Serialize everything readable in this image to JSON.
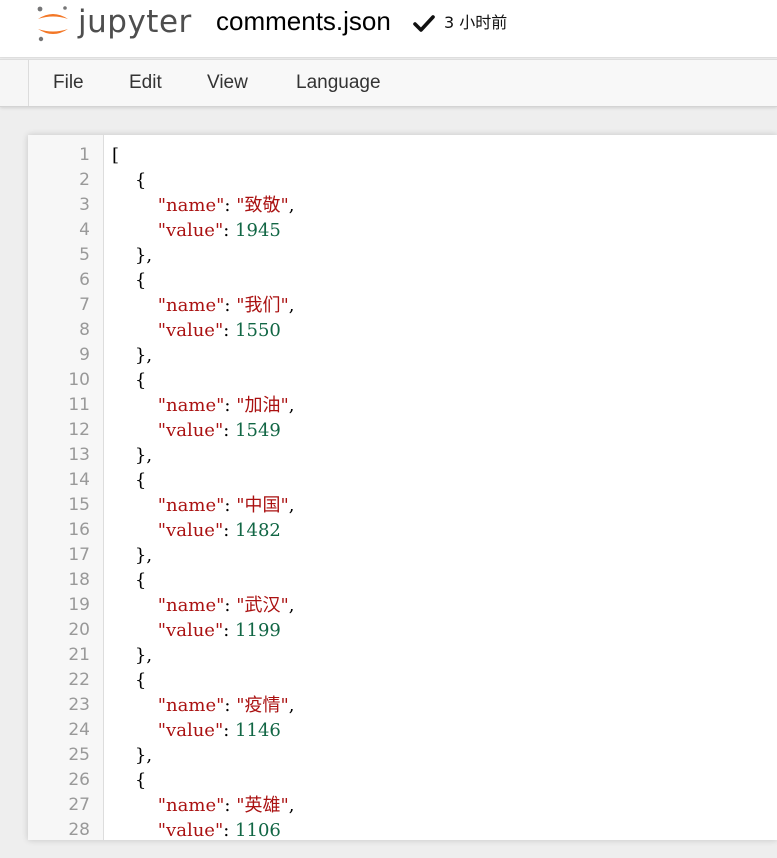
{
  "header": {
    "logo_text": "jupyter",
    "notebook_name": "comments.json",
    "save_status": "3 小时前"
  },
  "menu": {
    "items": [
      {
        "label": "File"
      },
      {
        "label": "Edit"
      },
      {
        "label": "View"
      },
      {
        "label": "Language"
      }
    ]
  },
  "colors": {
    "string": "#aa1111",
    "number": "#116644",
    "line_number": "#999999",
    "logo_orange": "#f37726",
    "logo_gray": "#767677"
  },
  "icons": {
    "logo": "jupyter-logo-icon",
    "checkpoint": "checkmark-icon"
  },
  "editor": {
    "lines": [
      {
        "num": "1",
        "tokens": [
          {
            "t": "punct",
            "v": "["
          }
        ]
      },
      {
        "num": "2",
        "tokens": [
          {
            "t": "punct",
            "v": "    {"
          }
        ]
      },
      {
        "num": "3",
        "tokens": [
          {
            "t": "punct",
            "v": "        "
          },
          {
            "t": "string",
            "v": "\"name\""
          },
          {
            "t": "punct",
            "v": ": "
          },
          {
            "t": "string",
            "v": "\"致敬\""
          },
          {
            "t": "punct",
            "v": ","
          }
        ]
      },
      {
        "num": "4",
        "tokens": [
          {
            "t": "punct",
            "v": "        "
          },
          {
            "t": "string",
            "v": "\"value\""
          },
          {
            "t": "punct",
            "v": ": "
          },
          {
            "t": "number",
            "v": "1945"
          }
        ]
      },
      {
        "num": "5",
        "tokens": [
          {
            "t": "punct",
            "v": "    },"
          }
        ]
      },
      {
        "num": "6",
        "tokens": [
          {
            "t": "punct",
            "v": "    {"
          }
        ]
      },
      {
        "num": "7",
        "tokens": [
          {
            "t": "punct",
            "v": "        "
          },
          {
            "t": "string",
            "v": "\"name\""
          },
          {
            "t": "punct",
            "v": ": "
          },
          {
            "t": "string",
            "v": "\"我们\""
          },
          {
            "t": "punct",
            "v": ","
          }
        ]
      },
      {
        "num": "8",
        "tokens": [
          {
            "t": "punct",
            "v": "        "
          },
          {
            "t": "string",
            "v": "\"value\""
          },
          {
            "t": "punct",
            "v": ": "
          },
          {
            "t": "number",
            "v": "1550"
          }
        ]
      },
      {
        "num": "9",
        "tokens": [
          {
            "t": "punct",
            "v": "    },"
          }
        ]
      },
      {
        "num": "10",
        "tokens": [
          {
            "t": "punct",
            "v": "    {"
          }
        ]
      },
      {
        "num": "11",
        "tokens": [
          {
            "t": "punct",
            "v": "        "
          },
          {
            "t": "string",
            "v": "\"name\""
          },
          {
            "t": "punct",
            "v": ": "
          },
          {
            "t": "string",
            "v": "\"加油\""
          },
          {
            "t": "punct",
            "v": ","
          }
        ]
      },
      {
        "num": "12",
        "tokens": [
          {
            "t": "punct",
            "v": "        "
          },
          {
            "t": "string",
            "v": "\"value\""
          },
          {
            "t": "punct",
            "v": ": "
          },
          {
            "t": "number",
            "v": "1549"
          }
        ]
      },
      {
        "num": "13",
        "tokens": [
          {
            "t": "punct",
            "v": "    },"
          }
        ]
      },
      {
        "num": "14",
        "tokens": [
          {
            "t": "punct",
            "v": "    {"
          }
        ]
      },
      {
        "num": "15",
        "tokens": [
          {
            "t": "punct",
            "v": "        "
          },
          {
            "t": "string",
            "v": "\"name\""
          },
          {
            "t": "punct",
            "v": ": "
          },
          {
            "t": "string",
            "v": "\"中国\""
          },
          {
            "t": "punct",
            "v": ","
          }
        ]
      },
      {
        "num": "16",
        "tokens": [
          {
            "t": "punct",
            "v": "        "
          },
          {
            "t": "string",
            "v": "\"value\""
          },
          {
            "t": "punct",
            "v": ": "
          },
          {
            "t": "number",
            "v": "1482"
          }
        ]
      },
      {
        "num": "17",
        "tokens": [
          {
            "t": "punct",
            "v": "    },"
          }
        ]
      },
      {
        "num": "18",
        "tokens": [
          {
            "t": "punct",
            "v": "    {"
          }
        ]
      },
      {
        "num": "19",
        "tokens": [
          {
            "t": "punct",
            "v": "        "
          },
          {
            "t": "string",
            "v": "\"name\""
          },
          {
            "t": "punct",
            "v": ": "
          },
          {
            "t": "string",
            "v": "\"武汉\""
          },
          {
            "t": "punct",
            "v": ","
          }
        ]
      },
      {
        "num": "20",
        "tokens": [
          {
            "t": "punct",
            "v": "        "
          },
          {
            "t": "string",
            "v": "\"value\""
          },
          {
            "t": "punct",
            "v": ": "
          },
          {
            "t": "number",
            "v": "1199"
          }
        ]
      },
      {
        "num": "21",
        "tokens": [
          {
            "t": "punct",
            "v": "    },"
          }
        ]
      },
      {
        "num": "22",
        "tokens": [
          {
            "t": "punct",
            "v": "    {"
          }
        ]
      },
      {
        "num": "23",
        "tokens": [
          {
            "t": "punct",
            "v": "        "
          },
          {
            "t": "string",
            "v": "\"name\""
          },
          {
            "t": "punct",
            "v": ": "
          },
          {
            "t": "string",
            "v": "\"疫情\""
          },
          {
            "t": "punct",
            "v": ","
          }
        ]
      },
      {
        "num": "24",
        "tokens": [
          {
            "t": "punct",
            "v": "        "
          },
          {
            "t": "string",
            "v": "\"value\""
          },
          {
            "t": "punct",
            "v": ": "
          },
          {
            "t": "number",
            "v": "1146"
          }
        ]
      },
      {
        "num": "25",
        "tokens": [
          {
            "t": "punct",
            "v": "    },"
          }
        ]
      },
      {
        "num": "26",
        "tokens": [
          {
            "t": "punct",
            "v": "    {"
          }
        ]
      },
      {
        "num": "27",
        "tokens": [
          {
            "t": "punct",
            "v": "        "
          },
          {
            "t": "string",
            "v": "\"name\""
          },
          {
            "t": "punct",
            "v": ": "
          },
          {
            "t": "string",
            "v": "\"英雄\""
          },
          {
            "t": "punct",
            "v": ","
          }
        ]
      },
      {
        "num": "28",
        "tokens": [
          {
            "t": "punct",
            "v": "        "
          },
          {
            "t": "string",
            "v": "\"value\""
          },
          {
            "t": "punct",
            "v": ": "
          },
          {
            "t": "number",
            "v": "1106"
          }
        ]
      }
    ]
  }
}
